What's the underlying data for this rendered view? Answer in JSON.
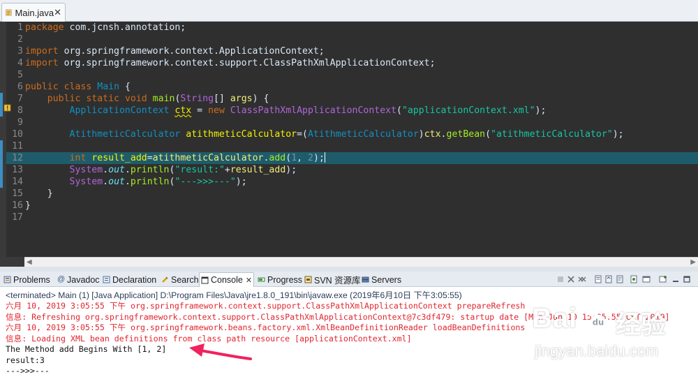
{
  "editor_tab": {
    "title": "Main.java",
    "close": "✕"
  },
  "code": [
    {
      "no": "1",
      "html": "<span class='kw'>package</span> com.jcnsh.annotation;"
    },
    {
      "no": "2",
      "html": ""
    },
    {
      "no": "3",
      "html": "<span class='kw'>import</span> org.springframework.context.ApplicationContext;"
    },
    {
      "no": "4",
      "html": "<span class='kw'>import</span> org.springframework.context.support.ClassPathXmlApplicationContext;"
    },
    {
      "no": "5",
      "html": ""
    },
    {
      "no": "6",
      "html": "<span class='kw'>public</span> <span class='kw'>class</span> <span class='cls'>Main</span> {"
    },
    {
      "no": "7",
      "html": "    <span class='kw'>public</span> <span class='kw'>static</span> <span class='kw'>void</span> <span class='mth'>main</span>(<span class='cls2'>String</span>[] <span class='var'>args</span>) {"
    },
    {
      "no": "8",
      "html": "        <span class='cls'>ApplicationContext</span> <span class='var2 warn-u'>ctx</span> = <span class='kw'>new</span> <span class='cls2'>ClassPathXmlApplicationContext</span>(<span class='str'>\"applicationContext.xml\"</span>);"
    },
    {
      "no": "9",
      "html": ""
    },
    {
      "no": "10",
      "html": "        <span class='cls'>AtithmeticCalculator</span> <span class='var2'>atithmeticCalculator</span>=(<span class='cls'>AtithmeticCalculator</span>)<span class='var'>ctx</span>.<span class='mth'>getBean</span>(<span class='str'>\"atithmeticCalculator\"</span>);"
    },
    {
      "no": "11",
      "html": ""
    },
    {
      "no": "12",
      "html": "        <span class='kw'>int</span> <span class='var2'>result_add</span>=<span class='var'>atithmeticCalculator</span>.<span class='mth'>add</span>(<span class='num'>1</span>, <span class='num'>2</span>);<span class='caret'></span>"
    },
    {
      "no": "13",
      "html": "        <span class='cls2'>System</span>.<span class='fld ital'>out</span>.<span class='mth'>println</span>(<span class='str'>\"result:\"</span>+<span class='var'>result_add</span>);"
    },
    {
      "no": "14",
      "html": "        <span class='cls2'>System</span>.<span class='fld ital'>out</span>.<span class='mth'>println</span>(<span class='str'>\"--->>>---\"</span>);"
    },
    {
      "no": "15",
      "html": "    }"
    },
    {
      "no": "16",
      "html": "}"
    },
    {
      "no": "17",
      "html": ""
    }
  ],
  "views": {
    "problems": "Problems",
    "javadoc": "Javadoc",
    "declaration": "Declaration",
    "search": "Search",
    "console": "Console",
    "console_close": "✕",
    "progress": "Progress",
    "svn": "SVN 资源库",
    "servers": "Servers"
  },
  "console": {
    "header": "<terminated> Main (1) [Java Application] D:\\Program Files\\Java\\jre1.8.0_191\\bin\\javaw.exe (2019年6月10日 下午3:05:55)",
    "lines": [
      {
        "type": "err",
        "text": "六月 10, 2019 3:05:55 下午 org.springframework.context.support.ClassPathXmlApplicationContext prepareRefresh"
      },
      {
        "type": "err",
        "text": "信息: Refreshing org.springframework.context.support.ClassPathXmlApplicationContext@7c3df479: startup date [Mon Jun 10 15:05:55 CST 2019]"
      },
      {
        "type": "err",
        "text": "六月 10, 2019 3:05:55 下午 org.springframework.beans.factory.xml.XmlBeanDefinitionReader loadBeanDefinitions"
      },
      {
        "type": "err",
        "text": "信息: Loading XML bean definitions from class path resource [applicationContext.xml]"
      },
      {
        "type": "out",
        "text": "The Method add Begins With [1, 2]"
      },
      {
        "type": "out",
        "text": "result:3"
      },
      {
        "type": "out",
        "text": "--->>>---"
      }
    ]
  },
  "watermark": {
    "brand": "Bai",
    "brand2": "经验",
    "url": "jingyan.baidu.com"
  },
  "colors": {
    "accent": "#1f5c6b",
    "arrow": "#f0235e",
    "error": "#e1262f"
  }
}
